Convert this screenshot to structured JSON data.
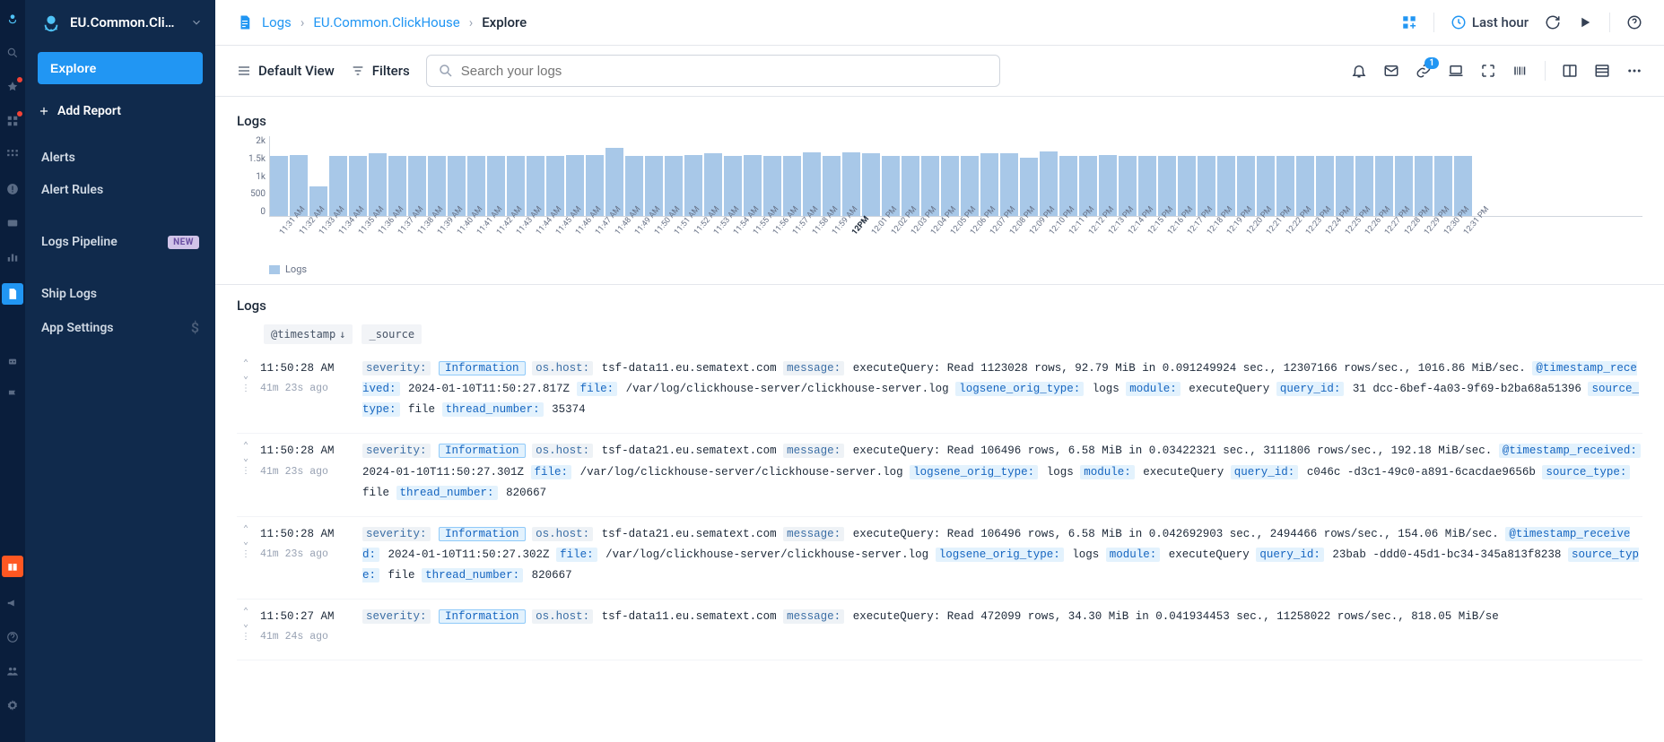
{
  "app": {
    "title": "EU.Common.Click..."
  },
  "sidebar": {
    "explore": "Explore",
    "add_report": "Add Report",
    "alerts": "Alerts",
    "alert_rules": "Alert Rules",
    "logs_pipeline": "Logs Pipeline",
    "badge_new": "NEW",
    "ship_logs": "Ship Logs",
    "app_settings": "App Settings"
  },
  "breadcrumb": {
    "logs": "Logs",
    "app": "EU.Common.ClickHouse",
    "current": "Explore"
  },
  "time_range": "Last hour",
  "subbar": {
    "default_view": "Default View",
    "filters": "Filters",
    "search_placeholder": "Search your logs",
    "link_badge": "1"
  },
  "chart_panel_title": "Logs",
  "chart_legend": "Logs",
  "chart_data": {
    "type": "bar",
    "ylabel": "",
    "ylim": [
      0,
      2000
    ],
    "yticks": [
      "2k",
      "1.5k",
      "1k",
      "500",
      "0"
    ],
    "categories": [
      "11:31 AM",
      "11:32 AM",
      "11:33 AM",
      "11:34 AM",
      "11:35 AM",
      "11:36 AM",
      "11:37 AM",
      "11:38 AM",
      "11:39 AM",
      "11:40 AM",
      "11:41 AM",
      "11:42 AM",
      "11:43 AM",
      "11:44 AM",
      "11:45 AM",
      "11:46 AM",
      "11:47 AM",
      "11:48 AM",
      "11:49 AM",
      "11:50 AM",
      "11:51 AM",
      "11:52 AM",
      "11:53 AM",
      "11:54 AM",
      "11:55 AM",
      "11:56 AM",
      "11:57 AM",
      "11:58 AM",
      "11:59 AM",
      "12PM",
      "12:01 PM",
      "12:02 PM",
      "12:03 PM",
      "12:04 PM",
      "12:05 PM",
      "12:06 PM",
      "12:07 PM",
      "12:08 PM",
      "12:09 PM",
      "12:10 PM",
      "12:11 PM",
      "12:12 PM",
      "12:13 PM",
      "12:14 PM",
      "12:15 PM",
      "12:16 PM",
      "12:17 PM",
      "12:18 PM",
      "12:19 PM",
      "12:20 PM",
      "12:21 PM",
      "12:22 PM",
      "12:23 PM",
      "12:24 PM",
      "12:25 PM",
      "12:26 PM",
      "12:27 PM",
      "12:28 PM",
      "12:29 PM",
      "12:30 PM",
      "12:31 PM"
    ],
    "values": [
      1500,
      1520,
      730,
      1500,
      1500,
      1550,
      1500,
      1500,
      1500,
      1500,
      1500,
      1500,
      1500,
      1500,
      1480,
      1520,
      1520,
      1700,
      1500,
      1500,
      1500,
      1520,
      1550,
      1500,
      1520,
      1500,
      1500,
      1580,
      1500,
      1580,
      1550,
      1480,
      1500,
      1500,
      1500,
      1500,
      1550,
      1550,
      1450,
      1600,
      1500,
      1500,
      1520,
      1480,
      1480,
      1500,
      1500,
      1500,
      1500,
      1500,
      1500,
      1500,
      1500,
      1500,
      1500,
      1500,
      1500,
      1500,
      1500,
      1500,
      1500
    ]
  },
  "logs_panel_title": "Logs",
  "columns": {
    "timestamp": "@timestamp",
    "source": "_source"
  },
  "log_entries": [
    {
      "time": "11:50:28 AM",
      "rel": "41m 23s ago",
      "severity": "Information",
      "os_host": "tsf-data11.eu.sematext.com",
      "message": "executeQuery: Read 1123028 rows, 92.79 MiB in 0.091249924 sec., 12307166 rows/sec., 1016.86 MiB/sec.",
      "timestamp_received": "2024-01-10T11:50:27.817Z",
      "file": "/var/log/clickhouse-server/clickhouse-server.log",
      "logsene_orig_type": "logs",
      "module": "executeQuery",
      "query_id_prefix": "31",
      "query_id_tail": "dcc-6bef-4a03-9f69-b2ba68a51396",
      "source_type": "file",
      "thread_number": "35374"
    },
    {
      "time": "11:50:28 AM",
      "rel": "41m 23s ago",
      "severity": "Information",
      "os_host": "tsf-data21.eu.sematext.com",
      "message": "executeQuery: Read 106496 rows, 6.58 MiB in 0.03422321 sec., 3111806 rows/sec., 192.18 MiB/sec.",
      "timestamp_received": "2024-01-10T11:50:27.301Z",
      "file": "/var/log/clickhouse-server/clickhouse-server.log",
      "logsene_orig_type": "logs",
      "module": "executeQuery",
      "query_id_prefix": "c046c",
      "query_id_tail": "-d3c1-49c0-a891-6cacdae9656b",
      "source_type": "file",
      "thread_number": "820667"
    },
    {
      "time": "11:50:28 AM",
      "rel": "41m 23s ago",
      "severity": "Information",
      "os_host": "tsf-data21.eu.sematext.com",
      "message": "executeQuery: Read 106496 rows, 6.58 MiB in 0.042692903 sec., 2494466 rows/sec., 154.06 MiB/sec.",
      "timestamp_received": "2024-01-10T11:50:27.302Z",
      "file": "/var/log/clickhouse-server/clickhouse-server.log",
      "logsene_orig_type": "logs",
      "module": "executeQuery",
      "query_id_prefix": "23bab",
      "query_id_tail": "-ddd0-45d1-bc34-345a813f8238",
      "source_type": "file",
      "thread_number": "820667"
    },
    {
      "time": "11:50:27 AM",
      "rel": "41m 24s ago",
      "severity": "Information",
      "os_host": "tsf-data11.eu.sematext.com",
      "message": "executeQuery: Read 472099 rows, 34.30 MiB in 0.041934453 sec., 11258022 rows/sec., 818.05 MiB/se",
      "timestamp_received": "",
      "file": "",
      "logsene_orig_type": "",
      "module": "",
      "query_id_prefix": "",
      "query_id_tail": "",
      "source_type": "",
      "thread_number": ""
    }
  ]
}
